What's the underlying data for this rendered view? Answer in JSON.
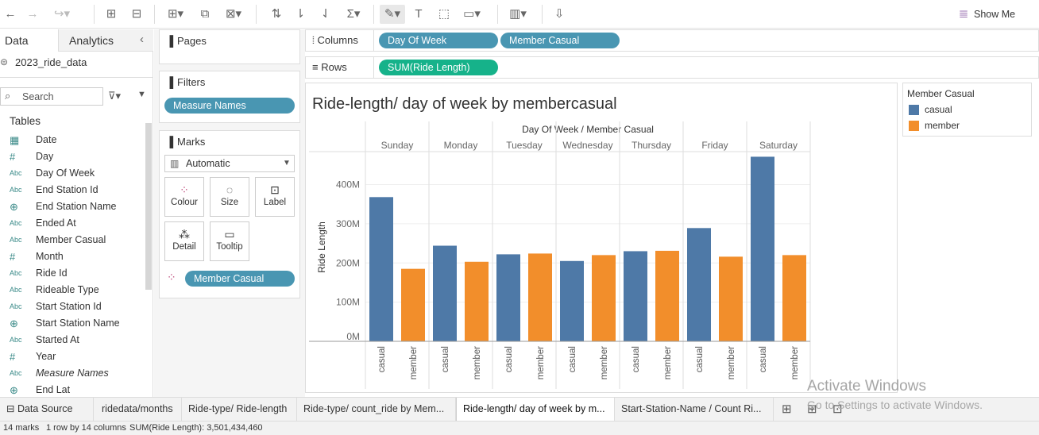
{
  "toolbar": {
    "show_me": "Show Me"
  },
  "data_pane": {
    "tab_data": "Data",
    "tab_analytics": "Analytics",
    "datasource": "2023_ride_data",
    "search_placeholder": "Search",
    "tables_heading": "Tables",
    "fields": [
      {
        "icon": "calendar",
        "type_glyph": "▦",
        "name": "Date"
      },
      {
        "icon": "number",
        "type_glyph": "#",
        "name": "Day"
      },
      {
        "icon": "string",
        "type_glyph": "Abc",
        "name": "Day Of Week"
      },
      {
        "icon": "string",
        "type_glyph": "Abc",
        "name": "End Station Id"
      },
      {
        "icon": "globe",
        "type_glyph": "⊕",
        "name": "End Station Name"
      },
      {
        "icon": "datetime",
        "type_glyph": "Abc",
        "name": "Ended At"
      },
      {
        "icon": "string",
        "type_glyph": "Abc",
        "name": "Member Casual"
      },
      {
        "icon": "number",
        "type_glyph": "#",
        "name": "Month"
      },
      {
        "icon": "string",
        "type_glyph": "Abc",
        "name": "Ride Id"
      },
      {
        "icon": "string",
        "type_glyph": "Abc",
        "name": "Rideable Type"
      },
      {
        "icon": "string",
        "type_glyph": "Abc",
        "name": "Start Station Id"
      },
      {
        "icon": "globe",
        "type_glyph": "⊕",
        "name": "Start Station Name"
      },
      {
        "icon": "datetime",
        "type_glyph": "Abc",
        "name": "Started At"
      },
      {
        "icon": "number",
        "type_glyph": "#",
        "name": "Year"
      },
      {
        "icon": "string",
        "type_glyph": "Abc",
        "name": "Measure Names"
      },
      {
        "icon": "globe",
        "type_glyph": "⊕",
        "name": "End Lat"
      }
    ]
  },
  "cards": {
    "pages_title": "Pages",
    "filters_title": "Filters",
    "filter_pill": "Measure Names",
    "marks_title": "Marks",
    "mark_type": "Automatic",
    "buttons": {
      "colour": "Colour",
      "size": "Size",
      "label": "Label",
      "detail": "Detail",
      "tooltip": "Tooltip"
    },
    "colour_pill": "Member Casual"
  },
  "shelves": {
    "columns_label": "Columns",
    "rows_label": "Rows",
    "columns": [
      "Day Of Week",
      "Member Casual"
    ],
    "rows": [
      "SUM(Ride Length)"
    ]
  },
  "legend": {
    "title": "Member Casual",
    "items": [
      {
        "name": "casual",
        "color": "#4e79a7"
      },
      {
        "name": "member",
        "color": "#f28e2b"
      }
    ]
  },
  "chart_data": {
    "type": "bar",
    "title": "Ride-length/ day of week by membercasual",
    "header_title": "Day Of Week / Member Casual",
    "ylabel": "Ride Length",
    "ylim": [
      0,
      480000000
    ],
    "yticks": [
      0,
      100000000,
      200000000,
      300000000,
      400000000
    ],
    "ytick_labels": [
      "0M",
      "100M",
      "200M",
      "300M",
      "400M"
    ],
    "categories": [
      "Sunday",
      "Monday",
      "Tuesday",
      "Wednesday",
      "Thursday",
      "Friday",
      "Saturday"
    ],
    "sub_categories": [
      "casual",
      "member"
    ],
    "series": [
      {
        "name": "casual",
        "color": "#4e79a7",
        "values": [
          368000000,
          244000000,
          222000000,
          205000000,
          230000000,
          289000000,
          471000000
        ]
      },
      {
        "name": "member",
        "color": "#f28e2b",
        "values": [
          185000000,
          203000000,
          224000000,
          220000000,
          231000000,
          216000000,
          220000000
        ]
      }
    ],
    "grid": true
  },
  "sheet_tabs": {
    "data_source": "Data Source",
    "tabs": [
      "ridedata/months",
      "Ride-type/ Ride-length",
      "Ride-type/ count_ride by Mem...",
      "Ride-length/ day of week by m...",
      "Start-Station-Name / Count Ri..."
    ],
    "active_index": 3
  },
  "status": {
    "marks": "14 marks",
    "dims": "1 row by 14 columns",
    "sum": "SUM(Ride Length): 3,501,434,460"
  },
  "watermark": {
    "line1": "Activate Windows",
    "line2": "Go to Settings to activate Windows."
  }
}
